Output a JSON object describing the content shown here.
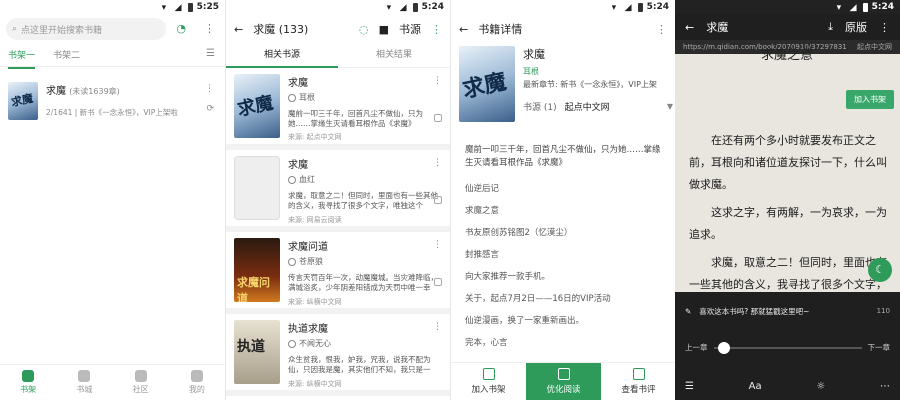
{
  "panel1": {
    "status_time": "5:25",
    "search_placeholder": "点这里开始搜索书籍",
    "tabs": [
      "书架一",
      "书架二"
    ],
    "book": {
      "title": "求魔",
      "unread": "(未读1639章)",
      "progress": "2/1641 | 新书《一念永恒》，VIP上架啦",
      "cover_text": "求魔"
    },
    "nav": [
      "书架",
      "书城",
      "社区",
      "我的"
    ]
  },
  "panel2": {
    "status_time": "5:24",
    "title": "求魔 (133)",
    "action_label": "书源",
    "tabs": [
      "相关书源",
      "相关结果"
    ],
    "items": [
      {
        "title": "求魔",
        "author": "耳根",
        "desc": "魔前一叩三千年，回首凡尘不做仙，只为她……掌缘生灭请看耳根作品《求魔》",
        "source": "来源: 起点中文网",
        "cover_text": "求魔"
      },
      {
        "title": "求魔",
        "author": "血红",
        "desc": "求魔，取意之二！但同时，里面也有一些其他的含义，我寻找了很多个文字，唯独这个求，…",
        "source": "来源: 网易云阅读",
        "cover_text": ""
      },
      {
        "title": "求魔问道",
        "author": "苍原狼",
        "desc": "传言天罚百年一次，动魔魔城。当灾难降临，满城浴炙，少年阴差阳错成为天罚中唯一幸存…",
        "source": "来源: 纵横中文网",
        "cover_text": "求魔问道"
      },
      {
        "title": "执道求魔",
        "author": "不闻无心",
        "desc": "众生贫我，恨我，妒我，咒我，说我不配为仙，只因我是魔，其实他们不知，我只是一个…",
        "source": "来源: 纵横中文网",
        "cover_text": "执道"
      }
    ]
  },
  "panel3": {
    "status_time": "5:24",
    "title": "书籍详情",
    "book_title": "求魔",
    "author": "耳根",
    "latest": "最新章节: 新书《一念永恒》，VIP上架",
    "source_label": "书源 (1)",
    "source_name": "起点中文网",
    "cover_text": "求魔",
    "description": "魔前一叩三千年，回首凡尘不做仙，只为她……掌缘生灭请看耳根作品《求魔》",
    "chapters": [
      "仙逆后记",
      "求魔之意",
      "书友原创苏铭图2（忆漠尘）",
      "封推感言",
      "向大家推荐一款手机。",
      "关于，起点7月2日——16日的VIP活动",
      "仙逆漫画，换了一家重新画出。",
      "完本，心言"
    ],
    "actions": [
      "加入书架",
      "优化阅读",
      "查看书评"
    ]
  },
  "panel4": {
    "status_time": "5:24",
    "title": "求魔",
    "mode_label": "原版",
    "url": "https://m.qidian.com/book/2070910/37297831",
    "source": "起点中文网",
    "chapter_heading": "求魔之意",
    "add_label": "加入书架",
    "paragraphs": [
      "在还有两个多小时就要发布正文之前，耳根向和诸位道友探讨一下，什么叫做求魔。",
      "这求之字，有两解，一为哀求，一为追求。",
      "求魔，取意之二！但同时，里面也有一些其他的含义，我寻找了很多个文字，唯独这求，可以贴近内心。"
    ],
    "comment_prompt": "喜欢这本书吗? 那就猛戳这里吧~",
    "comment_count": "110",
    "prev_label": "上一章",
    "next_label": "下一章",
    "reading_progress": 0.03
  }
}
